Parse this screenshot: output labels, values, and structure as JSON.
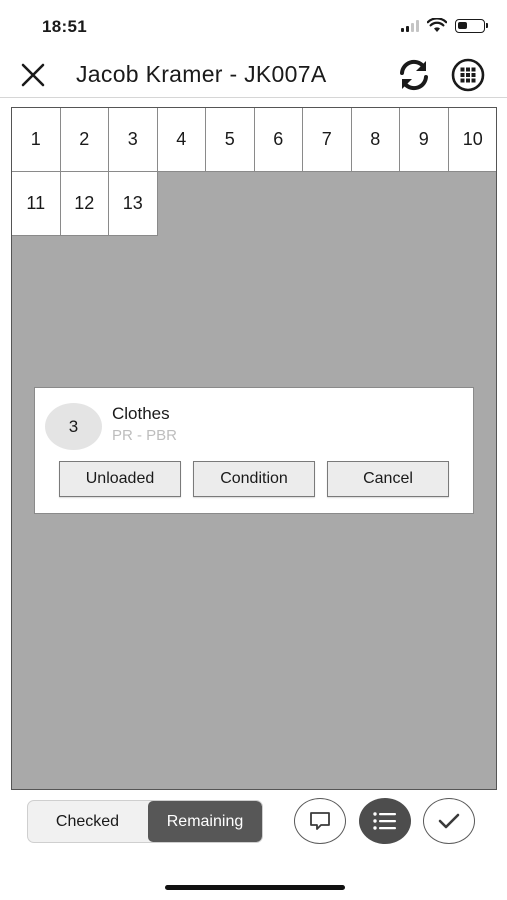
{
  "status_bar": {
    "time": "18:51",
    "icons": [
      "signal-icon",
      "wifi-icon",
      "battery-icon"
    ],
    "battery_level": 0.4
  },
  "header": {
    "title": "Jacob Kramer - JK007A",
    "close_icon": "close-icon",
    "refresh_icon": "refresh-icon",
    "grid_icon": "grid-menu-icon"
  },
  "grid": {
    "cells": [
      "1",
      "2",
      "3",
      "4",
      "5",
      "6",
      "7",
      "8",
      "9",
      "10",
      "11",
      "12",
      "13"
    ]
  },
  "popup": {
    "badge": "3",
    "title": "Clothes",
    "subtitle": "PR - PBR",
    "buttons": {
      "unloaded": "Unloaded",
      "condition": "Condition",
      "cancel": "Cancel"
    }
  },
  "bottom_bar": {
    "tabs": {
      "checked": "Checked",
      "remaining": "Remaining"
    },
    "selected_tab": "Remaining",
    "actions": [
      "comment-icon",
      "list-icon",
      "checkmark-icon"
    ]
  },
  "colors": {
    "grid_background": "#a9a9a9",
    "selected_segment": "#575757",
    "list_button": "#4d4d4d"
  }
}
